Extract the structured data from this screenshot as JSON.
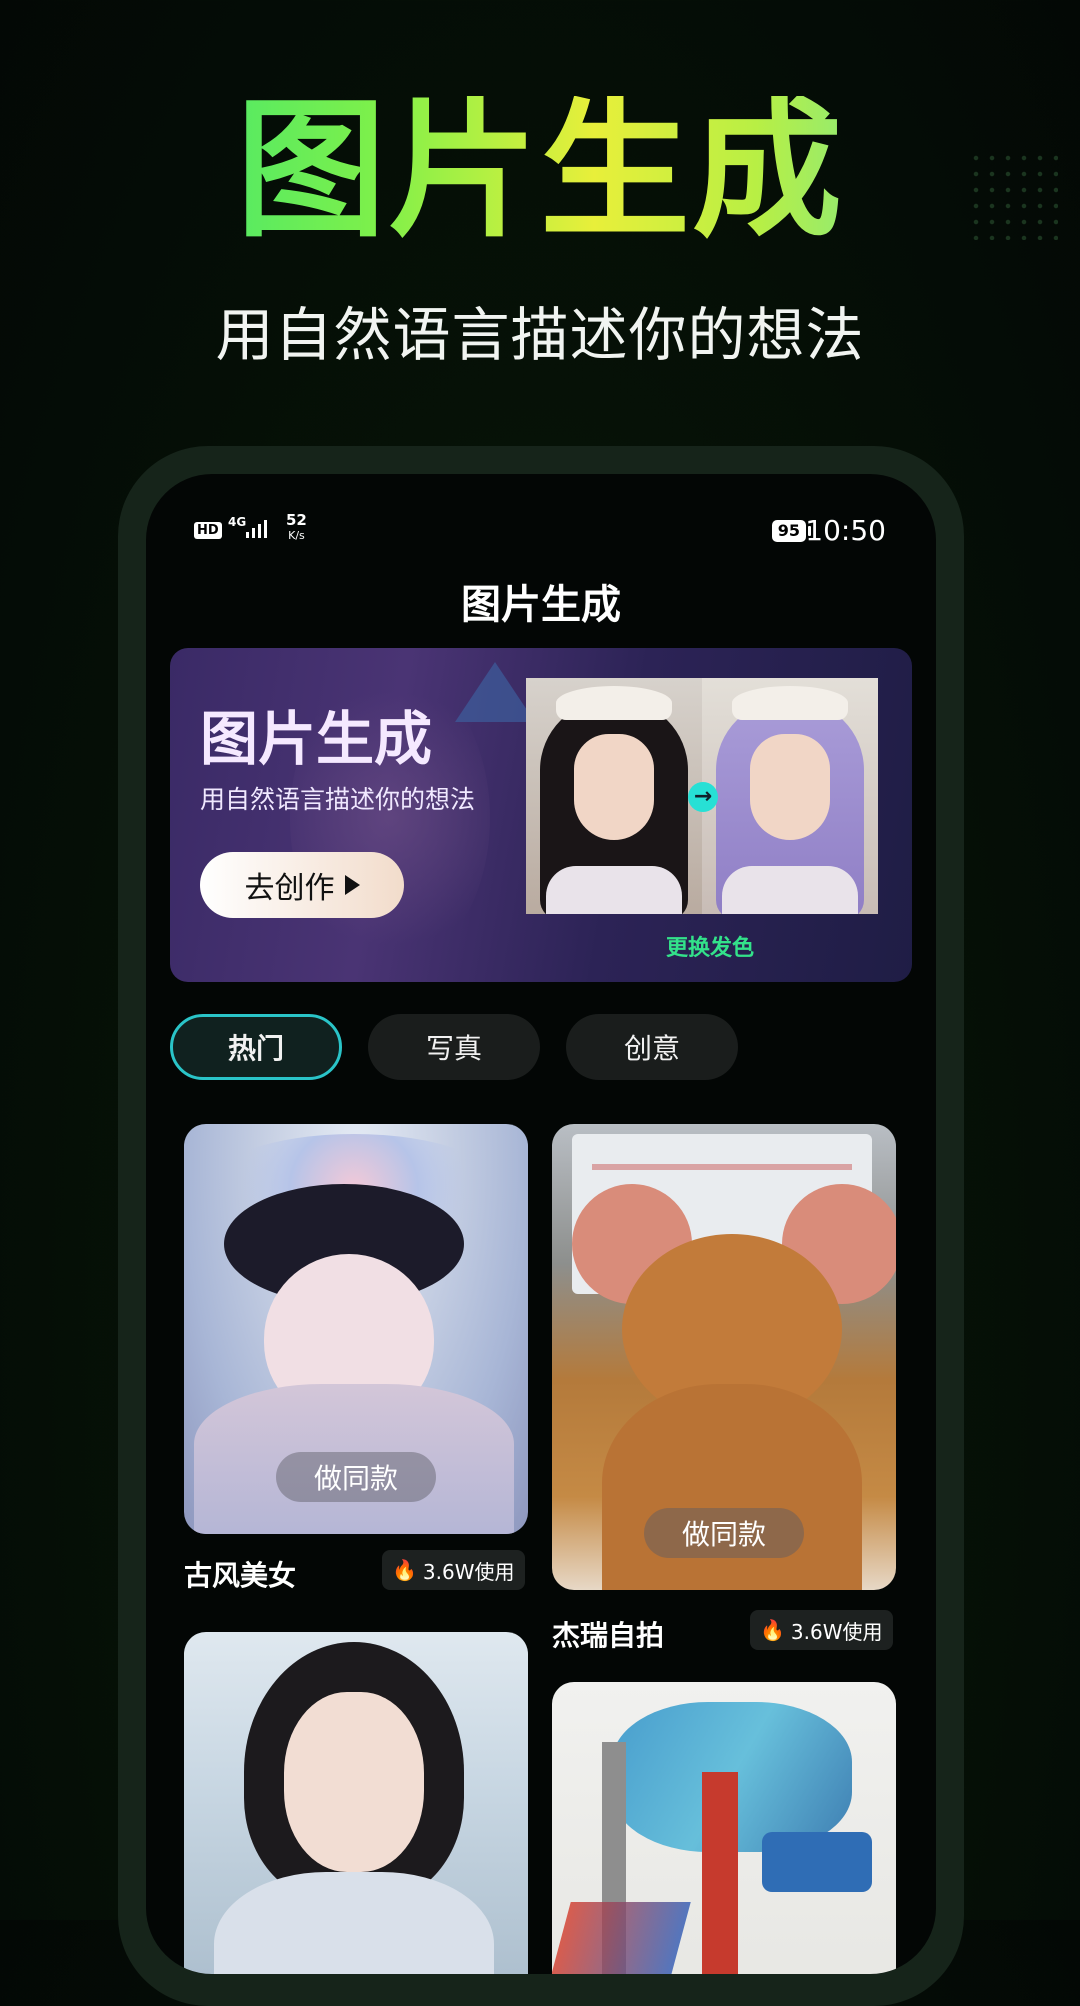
{
  "hero": {
    "title": "图片生成",
    "subtitle": "用自然语言描述你的想法"
  },
  "status_bar": {
    "hd": "HD",
    "network": "4G",
    "speed_value": "52",
    "speed_unit": "K/s",
    "battery": "95",
    "time": "10:50"
  },
  "app": {
    "page_title": "图片生成"
  },
  "banner": {
    "title": "图片生成",
    "subtitle": "用自然语言描述你的想法",
    "button_label": "去创作",
    "caption": "更换发色"
  },
  "tabs": [
    {
      "label": "热门",
      "active": true
    },
    {
      "label": "写真",
      "active": false
    },
    {
      "label": "创意",
      "active": false
    }
  ],
  "templates": [
    {
      "title": "古风美女",
      "usage": "3.6W使用",
      "button": "做同款"
    },
    {
      "title": "杰瑞自拍",
      "usage": "3.6W使用",
      "button": "做同款"
    }
  ],
  "colors": {
    "accent_tab_border": "#2ac4c8",
    "banner_caption": "#33e28a",
    "flame": "#ff7a1a"
  },
  "icons": {
    "play": "play-icon",
    "arrow": "arrow-right-icon",
    "flame": "fire-icon"
  }
}
